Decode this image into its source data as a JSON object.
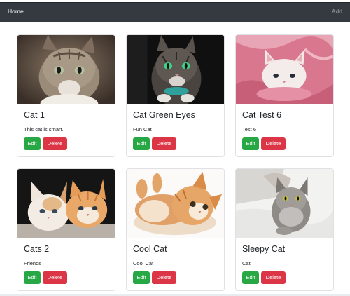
{
  "navbar": {
    "home_label": "Home",
    "add_label": "Add",
    "background": "#343a40"
  },
  "buttons": {
    "edit_color": "#28a745",
    "delete_color": "#dc3545"
  },
  "cards": [
    {
      "title": "Cat 1",
      "text": "This cat is smart.",
      "edit_label": "Edit",
      "delete_label": "Delete",
      "image": "tabby-cat-closeup"
    },
    {
      "title": "Cat Green Eyes",
      "text": "Fun Cat",
      "edit_label": "Edit",
      "delete_label": "Delete",
      "image": "green-eyed-tabby-dark-background"
    },
    {
      "title": "Cat Test 6",
      "text": "Test 6",
      "edit_label": "Edit",
      "delete_label": "Delete",
      "image": "white-kitten-pink-blanket"
    },
    {
      "title": "Cats 2",
      "text": "Friends",
      "edit_label": "Edit",
      "delete_label": "Delete",
      "image": "two-kittens"
    },
    {
      "title": "Cool Cat",
      "text": "Cool Cat",
      "edit_label": "Edit",
      "delete_label": "Delete",
      "image": "orange-kitten-rolling"
    },
    {
      "title": "Sleepy Cat",
      "text": "Cat",
      "edit_label": "Edit",
      "delete_label": "Delete",
      "image": "grey-fluffy-cat-on-bed"
    }
  ]
}
